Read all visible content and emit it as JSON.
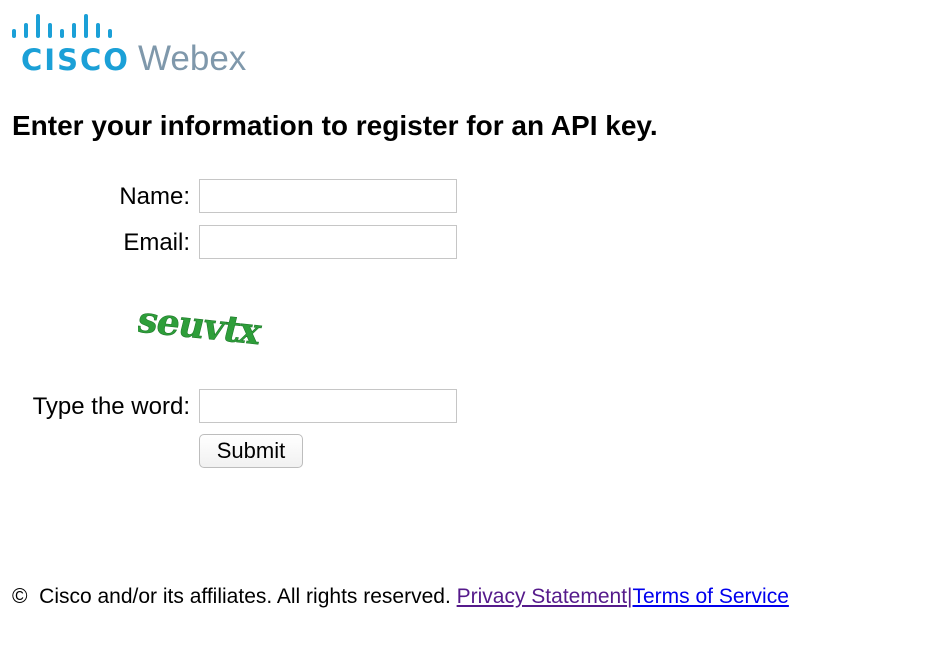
{
  "logo": {
    "brand": "CISCO",
    "product": "Webex",
    "cisco_color": "#1ba0d7",
    "webex_color": "#7f98ab"
  },
  "page": {
    "title": "Enter your information to register for an API key."
  },
  "form": {
    "name_label": "Name:",
    "name_value": "",
    "email_label": "Email:",
    "email_value": "",
    "captcha_word": "seuvtx",
    "captcha_color": "#2e9e3a",
    "word_label": "Type the word:",
    "word_value": "",
    "submit_label": "Submit"
  },
  "footer": {
    "copyright_symbol": "©",
    "copyright_text": "Cisco and/or its affiliates. All rights reserved.",
    "privacy_link": "Privacy Statement",
    "separator": "|",
    "terms_link": "Terms of Service"
  }
}
